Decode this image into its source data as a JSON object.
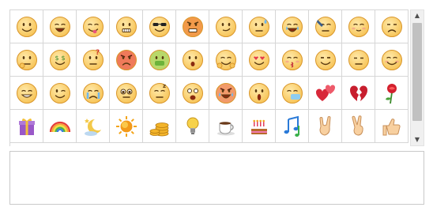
{
  "emoticons": [
    "smile-face-icon",
    "laughing-face-icon",
    "tongue-out-face-icon",
    "grimace-face-icon",
    "sunglasses-face-icon",
    "angry-face-icon",
    "smirk-face-icon",
    "sweat-face-icon",
    "crying-face-icon",
    "facepalm-face-icon",
    "shy-face-icon",
    "frown-face-icon",
    "thinking-face-icon",
    "money-eyes-face-icon",
    "question-face-icon",
    "red-angry-face-icon",
    "nauseous-face-icon",
    "surprised-face-icon",
    "hug-face-icon",
    "heart-eyes-face-icon",
    "kiss-face-icon",
    "scheming-face-icon",
    "bored-face-icon",
    "blushing-face-icon",
    "grin-face-icon",
    "wink-face-icon",
    "tears-face-icon",
    "puppy-eyes-face-icon",
    "sleepy-face-icon",
    "scared-face-icon",
    "furious-crying-face-icon",
    "shocked-face-icon",
    "sneeze-face-icon",
    "hearts-icon",
    "broken-heart-icon",
    "rose-icon",
    "gift-icon",
    "rainbow-icon",
    "moon-stars-icon",
    "sun-icon",
    "coins-icon",
    "light-bulb-icon",
    "coffee-cup-icon",
    "birthday-cake-icon",
    "music-notes-icon",
    "rock-hand-icon",
    "victory-hand-icon",
    "thumbs-up-icon"
  ],
  "message": {
    "value": "",
    "placeholder": ""
  },
  "colors": {
    "face": "#f7c55a",
    "face_edge": "#d9962a",
    "grid_border": "#d6d6d6",
    "scroll_thumb": "#c1c1c1"
  }
}
